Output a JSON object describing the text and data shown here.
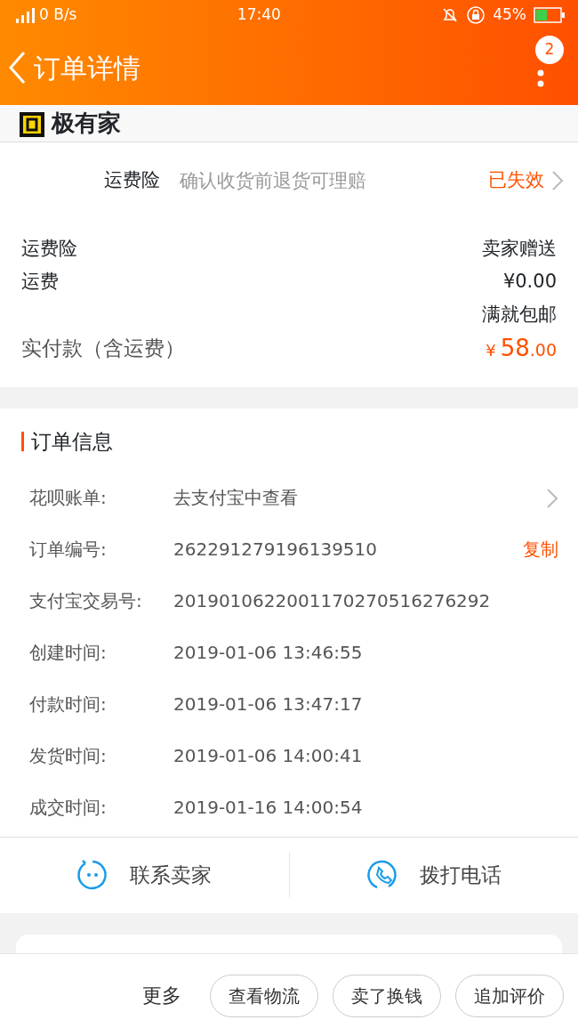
{
  "status_bar": {
    "network": "0 B/s",
    "time": "17:40",
    "battery": "45%"
  },
  "header": {
    "title": "订单详情",
    "badge": "2"
  },
  "shop_strip": {
    "logo_text": "极有家"
  },
  "insurance": {
    "label": "运费险",
    "description": "确认收货前退货可理赔",
    "status": "已失效"
  },
  "fees": [
    {
      "label": "运费险",
      "value": "卖家赠送"
    },
    {
      "label": "运费",
      "value": "¥0.00",
      "note": "满就包邮"
    }
  ],
  "total": {
    "label": "实付款（含运费）",
    "currency": "¥",
    "integer": "58",
    "decimal": ".00"
  },
  "order_info": {
    "title": "订单信息",
    "rows": [
      {
        "label": "花呗账单:",
        "value": "去支付宝中查看",
        "kind": "link"
      },
      {
        "label": "订单编号:",
        "value": "262291279196139510",
        "action": "复制",
        "kind": "copy"
      },
      {
        "label": "支付宝交易号:",
        "value": "2019010622001170270516276292",
        "kind": "plain"
      },
      {
        "label": "创建时间:",
        "value": "2019-01-06 13:46:55",
        "kind": "plain"
      },
      {
        "label": "付款时间:",
        "value": "2019-01-06 13:47:17",
        "kind": "plain"
      },
      {
        "label": "发货时间:",
        "value": "2019-01-06 14:00:41",
        "kind": "plain"
      },
      {
        "label": "成交时间:",
        "value": "2019-01-16 14:00:54",
        "kind": "plain"
      }
    ]
  },
  "contacts": [
    {
      "label": "联系卖家",
      "kind": "chat"
    },
    {
      "label": "拨打电话",
      "kind": "phone"
    }
  ],
  "bottom_bar": {
    "more": "更多",
    "buttons": [
      "查看物流",
      "卖了换钱",
      "追加评价"
    ]
  }
}
